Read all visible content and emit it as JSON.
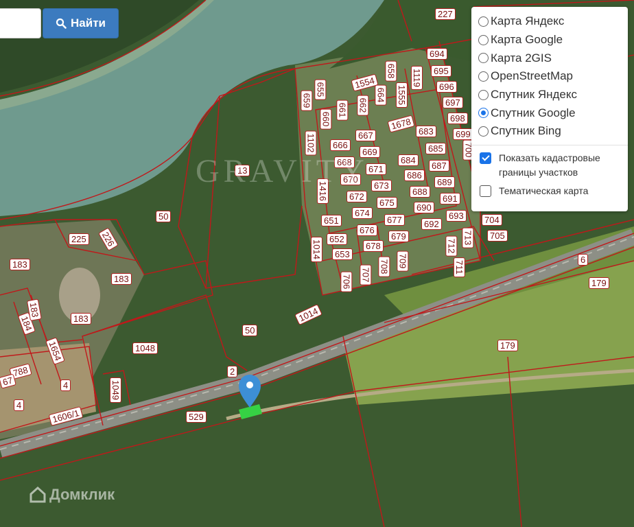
{
  "search": {
    "button_label": "Найти",
    "placeholder": ""
  },
  "layers": {
    "options": [
      {
        "label": "Карта Яндекс",
        "checked": false
      },
      {
        "label": "Карта Google",
        "checked": false
      },
      {
        "label": "Карта 2GIS",
        "checked": false
      },
      {
        "label": "OpenStreetMap",
        "checked": false
      },
      {
        "label": "Спутник Яндекс",
        "checked": false
      },
      {
        "label": "Спутник Google",
        "checked": true
      },
      {
        "label": "Спутник Bing",
        "checked": false
      }
    ],
    "cadastral_label": "Показать кадастровые границы участков",
    "cadastral_checked": true,
    "thematic_label": "Тематическая карта",
    "thematic_checked": false
  },
  "watermark": {
    "center": "GRAVITY",
    "brand": "Домклик"
  },
  "parcels": [
    "227",
    "694",
    "695",
    "696",
    "697",
    "698",
    "699",
    "700",
    "1554",
    "658",
    "1119",
    "655",
    "661",
    "662",
    "664",
    "1555",
    "659",
    "660",
    "1678",
    "683",
    "685",
    "667",
    "666",
    "669",
    "668",
    "671",
    "670",
    "673",
    "672",
    "675",
    "674",
    "677",
    "676",
    "679",
    "678",
    "684",
    "686",
    "687",
    "688",
    "689",
    "690",
    "691",
    "692",
    "693",
    "704",
    "705",
    "712",
    "713",
    "711",
    "1102",
    "1416",
    "651",
    "652",
    "653",
    "1014",
    "706",
    "707",
    "708",
    "709",
    "13",
    "50",
    "225",
    "226",
    "183",
    "6",
    "179",
    "1048",
    "2",
    "529",
    "4",
    "1049",
    "1606/1",
    "1654",
    "184",
    "788",
    "67"
  ],
  "colors": {
    "parcel_border": "#c0181a",
    "accent": "#3c7bbf",
    "marker": "#3d8fd6",
    "selected_parcel": "#36d244"
  }
}
